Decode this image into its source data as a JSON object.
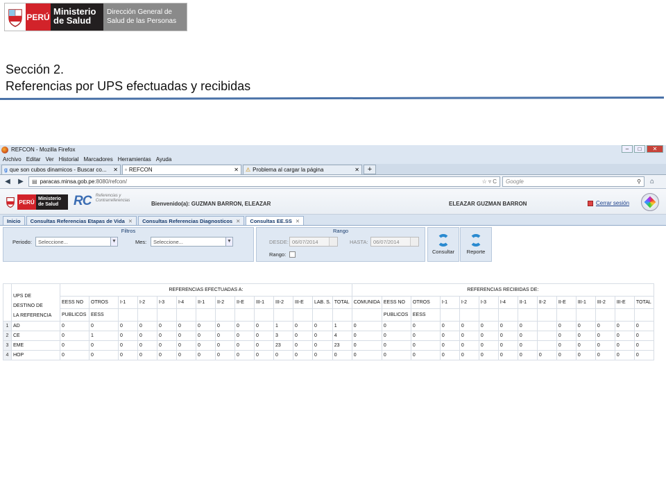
{
  "slide": {
    "logo": {
      "country": "PERÚ",
      "ministry": "Ministerio de Salud",
      "directorate": "Dirección General de Salud de las Personas"
    },
    "section": "Sección 2.",
    "title": "Referencias por UPS efectuadas y recibidas"
  },
  "browser": {
    "window_title": "REFCON - Mozilla Firefox",
    "menu": [
      "Archivo",
      "Editar",
      "Ver",
      "Historial",
      "Marcadores",
      "Herramientas",
      "Ayuda"
    ],
    "tabs": [
      {
        "label": "que son cubos dinamicos - Buscar co..."
      },
      {
        "label": "REFCON"
      },
      {
        "label": "Problema al cargar la página"
      }
    ],
    "url_host": "paracas.minsa.gob.pe",
    "url_rest": ":8080/refcon/",
    "search_placeholder": "Google"
  },
  "app": {
    "logo_country": "PERÚ",
    "logo_ministry": "Ministerio de Salud",
    "brand": "RC",
    "brand_sub": "Referencias y Contrarreferencias",
    "welcome": "Bienvenido(a): GUZMAN BARRON, ELEAZAR",
    "user": "ELEAZAR GUZMAN BARRON",
    "logout": "Cerrar sesión",
    "tabs": [
      "Inicio",
      "Consultas Referencias Etapas de Vida",
      "Consultas Referencias Diagnosticos",
      "Consultas EE.SS"
    ],
    "filters": {
      "title": "Filtros",
      "periodo_label": "Periodo:",
      "periodo_value": "Seleccione...",
      "mes_label": "Mes:",
      "mes_value": "Seleccione..."
    },
    "rango": {
      "title": "Rango",
      "desde_label": "DESDE:",
      "desde_value": "06/07/2014",
      "hasta_label": "HASTA:",
      "hasta_value": "06/07/2014",
      "rango_label": "Rango:"
    },
    "buttons": {
      "consultar": "Consultar",
      "reporte": "Reporte"
    },
    "table": {
      "row_header": [
        "UPS DE",
        "DESTINO DE",
        "LA REFERENCIA"
      ],
      "group_efectuadas": "REFERENCIAS EFECTUADAS A:",
      "group_recibidas": "REFERENCIAS RECIBIDAS DE:",
      "cols_efectuadas": [
        {
          "l1": "EESS NO",
          "l2": "PUBLICOS"
        },
        {
          "l1": "OTROS",
          "l2": "EESS"
        },
        {
          "l1": "I-1",
          "l2": ""
        },
        {
          "l1": "I-2",
          "l2": ""
        },
        {
          "l1": "I-3",
          "l2": ""
        },
        {
          "l1": "I-4",
          "l2": ""
        },
        {
          "l1": "II-1",
          "l2": ""
        },
        {
          "l1": "II-2",
          "l2": ""
        },
        {
          "l1": "II-E",
          "l2": ""
        },
        {
          "l1": "III-1",
          "l2": ""
        },
        {
          "l1": "III-2",
          "l2": ""
        },
        {
          "l1": "III-E",
          "l2": ""
        },
        {
          "l1": "LAB. S.",
          "l2": ""
        },
        {
          "l1": "TOTAL",
          "l2": ""
        }
      ],
      "cols_recibidas": [
        {
          "l1": "COMUNIDA",
          "l2": ""
        },
        {
          "l1": "EESS NO",
          "l2": "PUBLICOS"
        },
        {
          "l1": "OTROS",
          "l2": "EESS"
        },
        {
          "l1": "I-1",
          "l2": ""
        },
        {
          "l1": "I-2",
          "l2": ""
        },
        {
          "l1": "I-3",
          "l2": ""
        },
        {
          "l1": "I-4",
          "l2": ""
        },
        {
          "l1": "II-1",
          "l2": ""
        },
        {
          "l1": "II-2",
          "l2": ""
        },
        {
          "l1": "II-E",
          "l2": ""
        },
        {
          "l1": "III-1",
          "l2": ""
        },
        {
          "l1": "III-2",
          "l2": ""
        },
        {
          "l1": "III-E",
          "l2": ""
        },
        {
          "l1": "TOTAL",
          "l2": ""
        }
      ],
      "rows": [
        {
          "n": "1",
          "ups": "AD",
          "efect": [
            "0",
            "0",
            "0",
            "0",
            "0",
            "0",
            "0",
            "0",
            "0",
            "0",
            "1",
            "0",
            "0",
            "1"
          ],
          "recib": [
            "0",
            "0",
            "0",
            "0",
            "0",
            "0",
            "0",
            "0",
            "",
            "0",
            "0",
            "0",
            "0",
            "0"
          ]
        },
        {
          "n": "2",
          "ups": "CE",
          "efect": [
            "0",
            "1",
            "0",
            "0",
            "0",
            "0",
            "0",
            "0",
            "0",
            "0",
            "3",
            "0",
            "0",
            "4"
          ],
          "recib": [
            "0",
            "0",
            "0",
            "0",
            "0",
            "0",
            "0",
            "0",
            "",
            "0",
            "0",
            "0",
            "0",
            "0"
          ]
        },
        {
          "n": "3",
          "ups": "EME",
          "efect": [
            "0",
            "0",
            "0",
            "0",
            "0",
            "0",
            "0",
            "0",
            "0",
            "0",
            "23",
            "0",
            "0",
            "23"
          ],
          "recib": [
            "0",
            "0",
            "0",
            "0",
            "0",
            "0",
            "0",
            "0",
            "",
            "0",
            "0",
            "0",
            "0",
            "0"
          ]
        },
        {
          "n": "4",
          "ups": "HOP",
          "efect": [
            "0",
            "0",
            "0",
            "0",
            "0",
            "0",
            "0",
            "0",
            "0",
            "0",
            "0",
            "0",
            "0",
            "0"
          ],
          "recib": [
            "0",
            "0",
            "0",
            "0",
            "0",
            "0",
            "0",
            "0",
            "0",
            "0",
            "0",
            "0",
            "0",
            "0"
          ]
        }
      ]
    }
  }
}
